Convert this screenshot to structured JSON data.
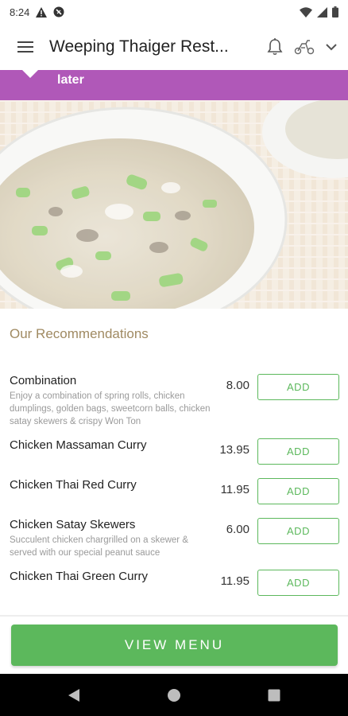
{
  "status": {
    "time": "8:24",
    "left_icons": [
      "alert-icon",
      "no-location-icon"
    ],
    "right_icons": [
      "wifi-icon",
      "signal-icon",
      "battery-icon"
    ]
  },
  "appbar": {
    "title": "Weeping Thaiger Rest...",
    "menu_icon": "hamburger-menu-icon",
    "notification_icon": "bell-icon",
    "mode_icon": "scooter-icon",
    "dropdown_icon": "chevron-down-icon"
  },
  "banner": {
    "text": "later",
    "color": "#b058b8"
  },
  "hero": {
    "image": "soup-bowl-photo"
  },
  "recommendations": {
    "title": "Our Recommendations",
    "items": [
      {
        "name": "Combination",
        "desc": "Enjoy a combination of spring rolls, chicken dumplings, golden bags, sweetcorn balls, chicken satay skewers & crispy Won Ton",
        "price": "8.00",
        "add_label": "ADD"
      },
      {
        "name": "Chicken Massaman Curry",
        "desc": "",
        "price": "13.95",
        "add_label": "ADD"
      },
      {
        "name": "Chicken Thai Red Curry",
        "desc": "",
        "price": "11.95",
        "add_label": "ADD"
      },
      {
        "name": "Chicken Satay Skewers",
        "desc": "Succulent chicken chargrilled on a skewer & served with our special peanut sauce",
        "price": "6.00",
        "add_label": "ADD"
      },
      {
        "name": "Chicken Thai Green Curry",
        "desc": "",
        "price": "11.95",
        "add_label": "ADD"
      }
    ]
  },
  "footer": {
    "view_menu_label": "VIEW MENU",
    "accent": "#5cb85c"
  },
  "nav": {
    "back_icon": "back-triangle-icon",
    "home_icon": "home-circle-icon",
    "recents_icon": "recents-square-icon"
  }
}
